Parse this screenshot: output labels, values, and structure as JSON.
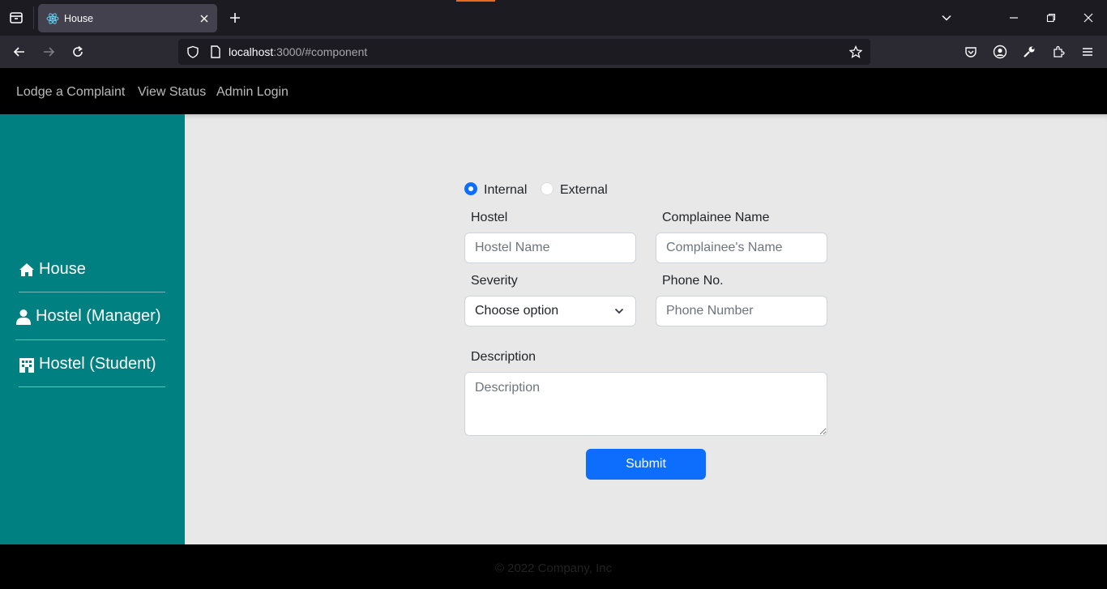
{
  "browser": {
    "tab_title": "House",
    "url_host": "localhost",
    "url_rest": ":3000/#component"
  },
  "header": {
    "links": [
      "Lodge a Complaint",
      "View Status",
      "Admin Login"
    ]
  },
  "sidebar": {
    "items": [
      {
        "label": "House",
        "icon": "home-icon"
      },
      {
        "label": "Hostel (Manager)",
        "icon": "user-icon"
      },
      {
        "label": "Hostel (Student)",
        "icon": "building-icon"
      }
    ]
  },
  "form": {
    "type_options": [
      {
        "label": "Internal",
        "selected": true
      },
      {
        "label": "External",
        "selected": false
      }
    ],
    "hostel_label": "Hostel",
    "hostel_placeholder": "Hostel Name",
    "complainee_label": "Complainee Name",
    "complainee_placeholder": "Complainee's Name",
    "severity_label": "Severity",
    "severity_value": "Choose option",
    "phone_label": "Phone No.",
    "phone_placeholder": "Phone Number",
    "description_label": "Description",
    "description_placeholder": "Description",
    "submit_label": "Submit"
  },
  "footer": {
    "copyright": "© 2022 Company, Inc"
  },
  "colors": {
    "sidebar": "#008080",
    "primary": "#0d6efd",
    "main_bg": "#e8e8e8"
  }
}
